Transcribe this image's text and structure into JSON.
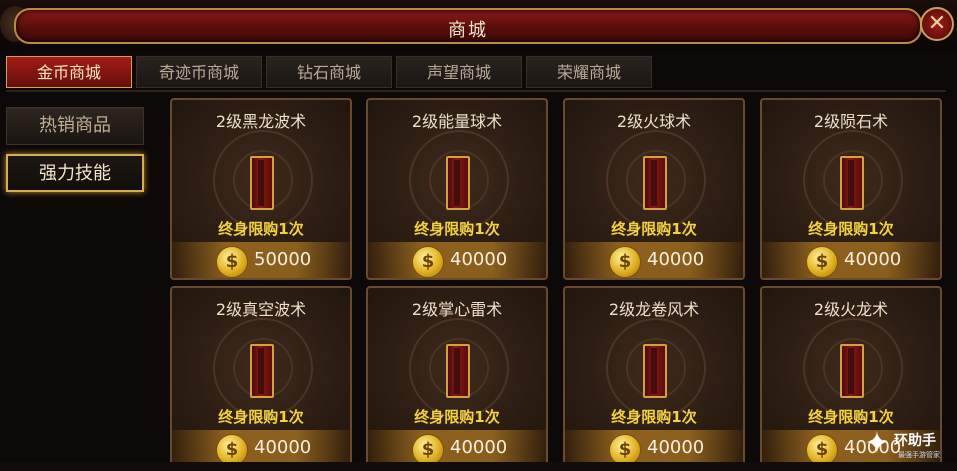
{
  "window": {
    "title": "商城",
    "close_icon": "close-x-icon"
  },
  "tabs": [
    {
      "label": "金币商城",
      "active": true
    },
    {
      "label": "奇迹币商城",
      "active": false
    },
    {
      "label": "钻石商城",
      "active": false
    },
    {
      "label": "声望商城",
      "active": false
    },
    {
      "label": "荣耀商城",
      "active": false
    }
  ],
  "sidebar": [
    {
      "label": "热销商品",
      "active": false
    },
    {
      "label": "强力技能",
      "active": true
    }
  ],
  "items": [
    {
      "name": "2级黑龙波术",
      "limit": "终身限购1次",
      "price": "50000",
      "currency_icon": "gold-coin-icon"
    },
    {
      "name": "2级能量球术",
      "limit": "终身限购1次",
      "price": "40000",
      "currency_icon": "gold-coin-icon"
    },
    {
      "name": "2级火球术",
      "limit": "终身限购1次",
      "price": "40000",
      "currency_icon": "gold-coin-icon"
    },
    {
      "name": "2级陨石术",
      "limit": "终身限购1次",
      "price": "40000",
      "currency_icon": "gold-coin-icon"
    },
    {
      "name": "2级真空波术",
      "limit": "终身限购1次",
      "price": "40000",
      "currency_icon": "gold-coin-icon"
    },
    {
      "name": "2级掌心雷术",
      "limit": "终身限购1次",
      "price": "40000",
      "currency_icon": "gold-coin-icon"
    },
    {
      "name": "2级龙卷风术",
      "limit": "终身限购1次",
      "price": "40000",
      "currency_icon": "gold-coin-icon"
    },
    {
      "name": "2级火龙术",
      "limit": "终身限购1次",
      "price": "40000",
      "currency_icon": "gold-coin-icon"
    }
  ],
  "coin_symbol": "$",
  "watermark": {
    "text": "环助手",
    "sub": "最强手游管家"
  },
  "colors": {
    "accent_red": "#a41c16",
    "gold_border": "#d6ae52",
    "limit_yellow": "#f2d240"
  }
}
